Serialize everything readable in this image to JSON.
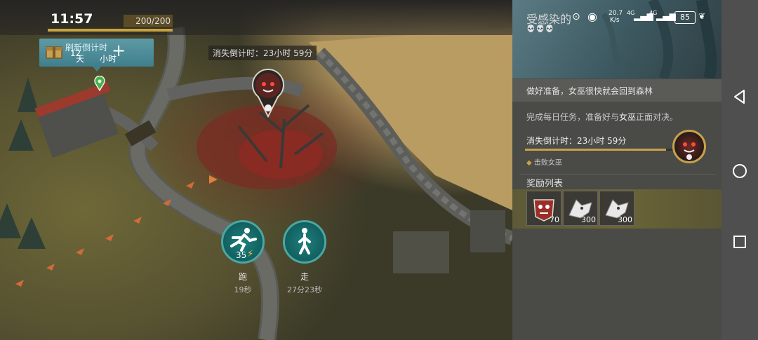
{
  "status_bar": {
    "time": "11:57",
    "net_speed": "20.7\nK/s",
    "net_speed_top": "20.7",
    "net_speed_bottom": "K/s",
    "signal1": "4G",
    "signal2": "4G",
    "battery": "85"
  },
  "hud": {
    "energy": "200/200",
    "energy_fraction": 1.0,
    "refresh_label": "刷新倒计时",
    "refresh_value": "12",
    "refresh_unit_day": "天",
    "refresh_unit_hour": "小时",
    "add": "+"
  },
  "map": {
    "countdown": "消失倒计时：23小时 59分",
    "run": {
      "cost": "35",
      "label": "跑",
      "time": "19秒"
    },
    "walk": {
      "label": "走",
      "time": "27分23秒"
    }
  },
  "panel": {
    "title": "受感染的",
    "skulls": "💀💀💀",
    "close": "✕",
    "subtitle": "做好准备，女巫很快就会回到森林",
    "desc_prefix": "完成每日任务，准备好与",
    "desc_highlight": "女巫",
    "desc_suffix": "正面对决。",
    "countdown": "消失倒计时：23小时 59分",
    "countdown_fraction": 0.92,
    "objective_bullet": "◆",
    "objective": "击败女巫",
    "rewards_title": "奖励列表",
    "rewards": [
      {
        "name": "pet-collar",
        "qty": "70"
      },
      {
        "name": "wolf-head",
        "qty": "300"
      },
      {
        "name": "wolf-head",
        "qty": "300"
      }
    ]
  },
  "colors": {
    "accent": "#c6a24a",
    "teal": "#11605f"
  }
}
